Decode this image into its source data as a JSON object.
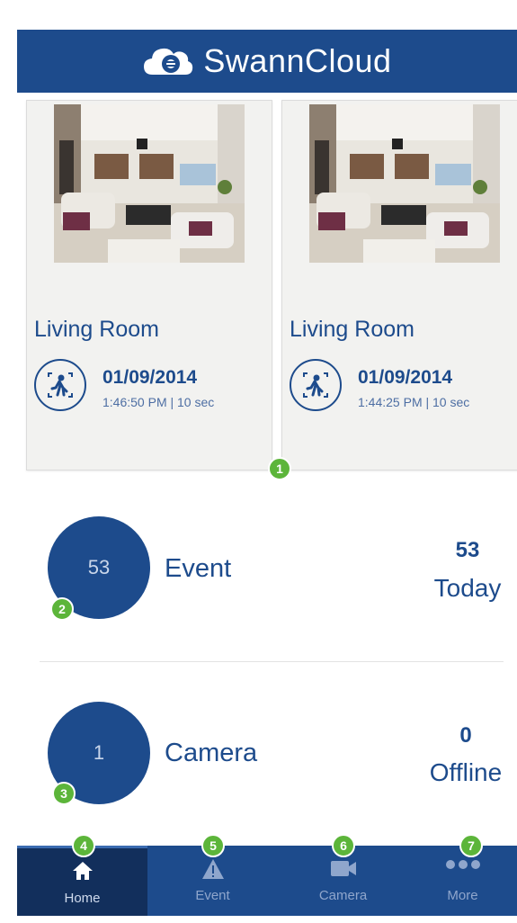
{
  "header": {
    "title": "SwannCloud",
    "logo_icon": "cloud-camera-icon"
  },
  "recordings": [
    {
      "camera": "Living Room",
      "date": "01/09/2014",
      "time": "1:46:50 PM | 10 sec",
      "icon": "motion-detected-icon"
    },
    {
      "camera": "Living Room",
      "date": "01/09/2014",
      "time": "1:44:25 PM | 10 sec",
      "icon": "motion-detected-icon"
    }
  ],
  "badges": [
    "1",
    "2",
    "3",
    "4",
    "5",
    "6",
    "7"
  ],
  "stats": {
    "event": {
      "count": "53",
      "label": "Event",
      "value": "53",
      "sub": "Today"
    },
    "camera": {
      "count": "1",
      "label": "Camera",
      "value": "0",
      "sub": "Offline"
    }
  },
  "nav": [
    {
      "label": "Home",
      "icon": "home-icon",
      "active": true
    },
    {
      "label": "Event",
      "icon": "warning-icon",
      "active": false
    },
    {
      "label": "Camera",
      "icon": "video-camera-icon",
      "active": false
    },
    {
      "label": "More",
      "icon": "more-dots-icon",
      "active": false
    }
  ],
  "colors": {
    "brand": "#1d4b8c",
    "badge": "#5cb53a",
    "nav_active": "#122f5c"
  }
}
